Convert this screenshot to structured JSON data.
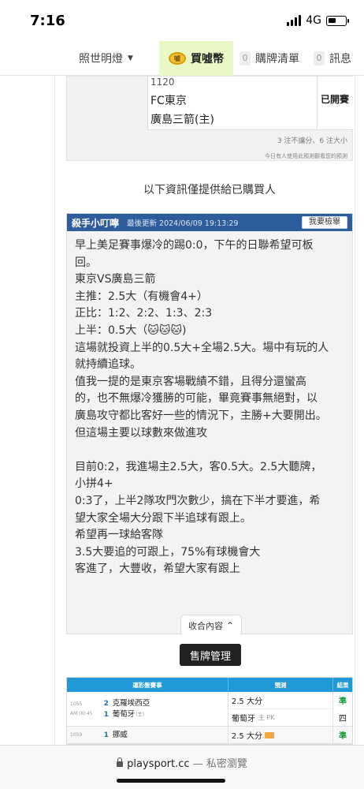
{
  "status_bar": {
    "time": "7:16",
    "network": "4G"
  },
  "nav": {
    "lamp_label": "照世明燈",
    "buy_label": "買噓幣",
    "coin_icon": "coin-icon",
    "cart_count": "0",
    "cart_label": "購牌清單",
    "msg_count": "0",
    "msg_label": "訊息"
  },
  "prediction": {
    "code": "1120",
    "away_team": "FC東京",
    "home_team": "廣島三箭(主)",
    "status": "已開賽",
    "stats": "3 注不讓分、6 注大小",
    "note": "今日有人使用此預測觀看您的預測"
  },
  "buyer_note": "以下資訊僅提供給已購買人",
  "article": {
    "author": "殺手小叮嚀",
    "updated": "最後更新 2024/06/09 19:13:29",
    "report_label": "我要檢舉",
    "lines": [
      "早上美足賽事爆冷的踢0:0，下午的日聯希望可板",
      "回。",
      "東京VS廣島三箭",
      "主推：2.5大（有機會4+）",
      "正比：1:2、2:2、1:3、2:3",
      "上半：0.5大（🐱🐱🐱)",
      "這場就投資上半的0.5大+全場2.5大。場中有玩的人",
      "就持續追球。",
      "值我一提的是東京客場戰績不錯，且得分還蠻高",
      "的，也不無爆冷獲勝的可能，畢竟賽事無絕對，以",
      "廣島攻守都比客好一些的情況下，主勝+大要開出。",
      "但這場主要以球數來做進攻",
      "",
      "目前0:2，我進場主2.5大，客0.5大。2.5大聽牌，",
      "小拼4+",
      "0:3了，上半2隊攻門次數少，搞在下半才要進，希",
      "望大家全場大分跟下半追球有跟上。",
      "希望再一球給客隊",
      "3.5大要追的可跟上，75%有球機會大",
      "客進了，大豐收，希望大家有跟上"
    ],
    "collapse_label": "收合內容"
  },
  "manage_button": "售牌管理",
  "table": {
    "headers": {
      "event": "運彩盤賽事",
      "prediction": "預測",
      "result": "結果"
    },
    "rows": [
      {
        "code": "1055",
        "time": "AM 00:45",
        "team1_rank": "2",
        "team1": "克羅埃西亞",
        "team2_rank": "1",
        "team2": "葡萄牙",
        "team2_tag": "(主)",
        "pred1": "2.5 大分",
        "pred2": "葡萄牙",
        "pred2_sub": "主 PK",
        "res1": "準",
        "res2": "四"
      },
      {
        "code": "1059",
        "team1_rank": "1",
        "team1": "挪威",
        "pred1": "2.5 大分",
        "res1": "準"
      }
    ]
  },
  "safari": {
    "url": "playsport.cc",
    "mode": "— 私密瀏覽"
  }
}
